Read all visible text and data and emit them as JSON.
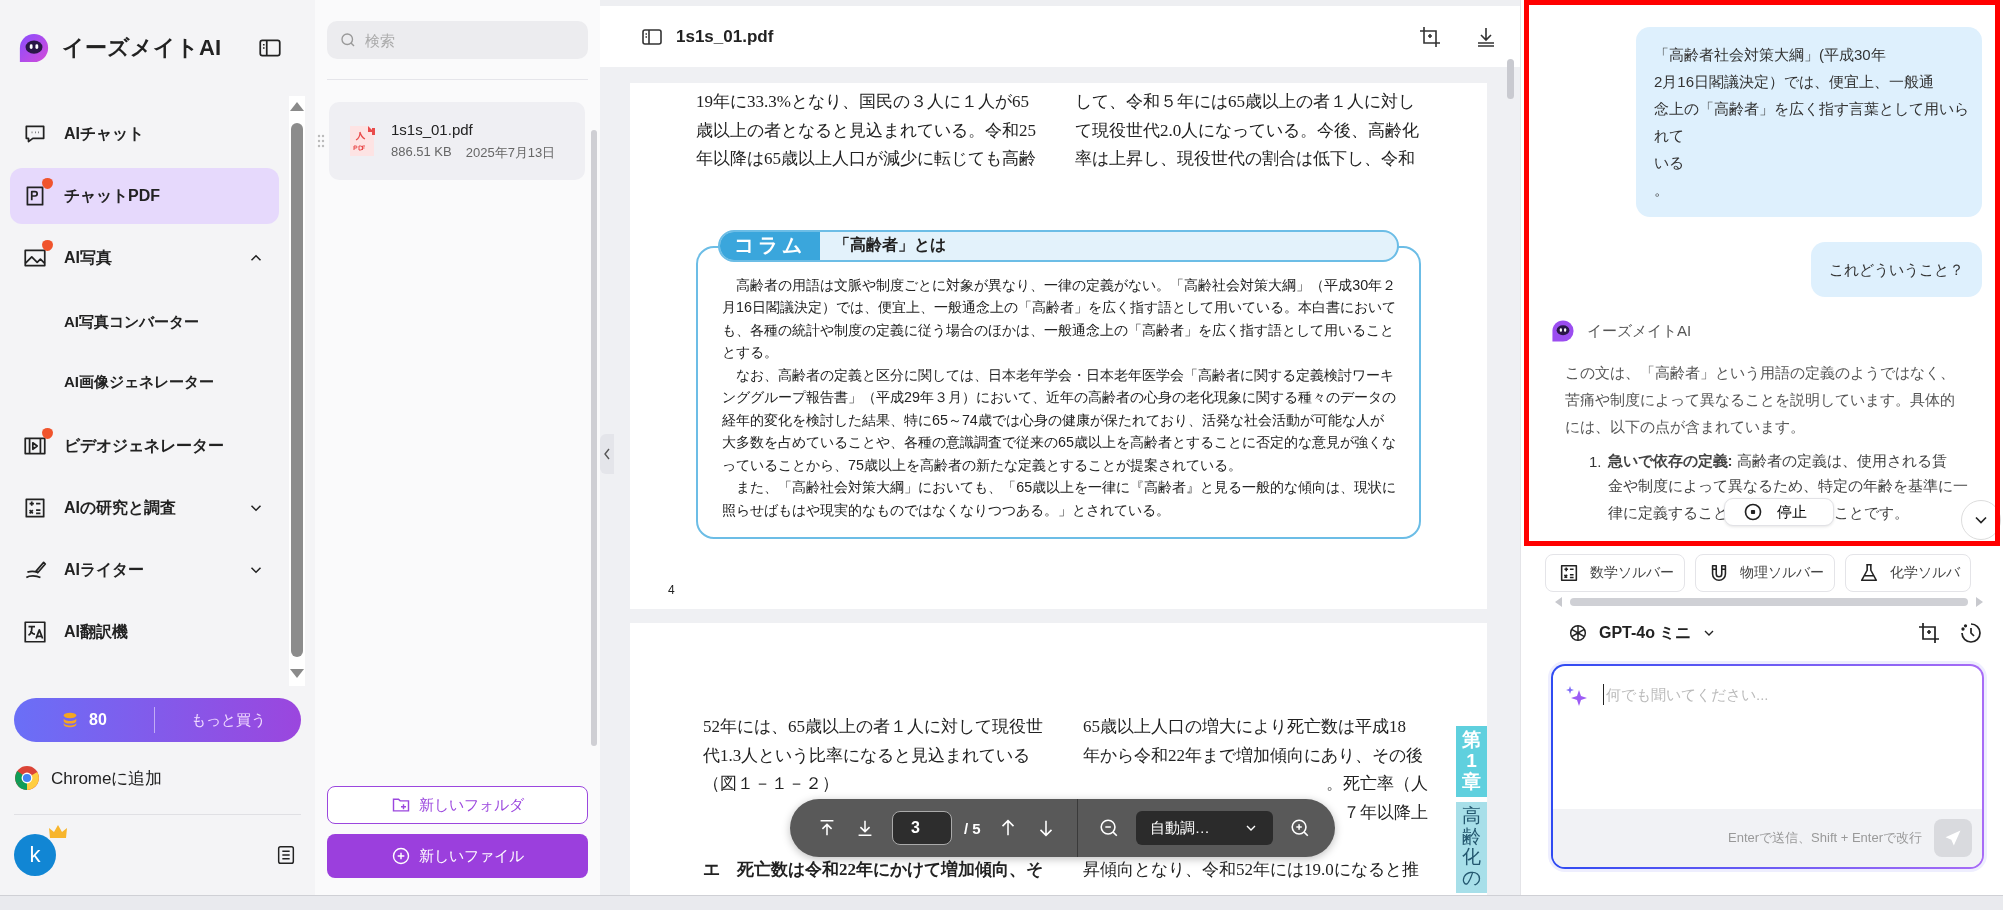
{
  "sidebar": {
    "app_name": "イーズメイトAI",
    "items": [
      {
        "label": "AIチャット",
        "selected": false,
        "badge": false
      },
      {
        "label": "チャットPDF",
        "selected": true,
        "badge": true
      },
      {
        "label": "AI写真",
        "selected": false,
        "badge": true,
        "expanded": true,
        "children": [
          {
            "label": "AI写真コンバーター",
            "selected": false
          },
          {
            "label": "AI画像ジェネレーター",
            "selected": false
          }
        ]
      },
      {
        "label": "ビデオジェネレーター",
        "selected": false,
        "badge": true
      },
      {
        "label": "AIの研究と調査",
        "selected": false,
        "badge": false,
        "expanded": false
      },
      {
        "label": "AIライター",
        "selected": false,
        "badge": false,
        "expanded": false
      },
      {
        "label": "AI翻訳機",
        "selected": false,
        "badge": false
      }
    ],
    "credits": {
      "count": "80",
      "buy_label": "もっと買う"
    },
    "extension": "Chromeに追加",
    "avatar": "k"
  },
  "files": {
    "search_placeholder": "検索",
    "items": [
      {
        "name": "1s1s_01.pdf",
        "size": "886.51 KB",
        "date": "2025年7月13日"
      }
    ],
    "new_folder": "新しいフォルダ",
    "new_file": "新しいファイル"
  },
  "viewer": {
    "title": "1s1s_01.pdf",
    "page_1": {
      "columns": [
        [
          "19年に33.3%となり、国民の３人に１人が65",
          "歳以上の者となると見込まれている。令和25",
          "年以降は65歳以上人口が減少に転じても高齢"
        ],
        [
          "して、令和５年には65歳以上の者１人に対し",
          "て現役世代2.0人になっている。今後、高齢化",
          "率は上昇し、現役世代の割合は低下し、令和"
        ]
      ],
      "column_box": {
        "tab": "コラム",
        "title": "「高齢者」とは",
        "paragraphs": [
          "高齢者の用語は文脈や制度ごとに対象が異なり、一律の定義がない。「高齢社会対策大綱」（平成30年２月16日閣議決定）では、便宜上、一般通念上の「高齢者」を広く指す語として用いている。本白書においても、各種の統計や制度の定義に従う場合のほかは、一般通念上の「高齢者」を広く指す語として用いることとする。",
          "なお、高齢者の定義と区分に関しては、日本老年学会・日本老年医学会「高齢者に関する定義検討ワーキンググループ報告書」（平成29年３月）において、近年の高齢者の心身の老化現象に関する種々のデータの経年的変化を検討した結果、特に65～74歳では心身の健康が保たれており、活発な社会活動が可能な人が大多数を占めていることや、各種の意識調査で従来の65歳以上を高齢者とすることに否定的な意見が強くなっていることから、75歳以上を高齢者の新たな定義とすることが提案されている。",
          "また、「高齢社会対策大綱」においても、「65歳以上を一律に『高齢者』と見る一般的な傾向は、現状に照らせばもはや現実的なものではなくなりつつある。」とされている。"
        ]
      },
      "page_number": "4"
    },
    "page_2": {
      "columns": [
        [
          {
            "kind": "line",
            "text": "52年には、65歳以上の者１人に対して現役世"
          },
          {
            "kind": "line",
            "text": "代1.3人という比率になると見込まれている"
          },
          {
            "kind": "line",
            "text": "（図１－１－２）"
          },
          {
            "kind": "heading",
            "text": "エ　死亡数は令和22年にかけて増加傾向、そ"
          }
        ],
        [
          {
            "kind": "line",
            "text": "65歳以上人口の増大により死亡数は平成18"
          },
          {
            "kind": "line",
            "text": "年から令和22年まで増加傾向にあり、その後"
          },
          {
            "kind": "fragment",
            "text": "。死亡率（人"
          },
          {
            "kind": "fragment",
            "text": "７年以降上"
          },
          {
            "kind": "line",
            "text": "昇傾向となり、令和52年には19.0になると推"
          }
        ]
      ],
      "side_tabs": [
        {
          "text": "第1章",
          "selected": true
        },
        {
          "text": "高齢化の",
          "selected": false
        }
      ]
    },
    "toolbar": {
      "page": "3",
      "total": "/ 5",
      "zoom": "自動調…"
    }
  },
  "chat": {
    "messages": [
      {
        "kind": "user",
        "lines": [
          "「高齢者社会対策大綱」(平成30年",
          "2月16日閣議決定）では、便宜上、一般通",
          "念上の「高齢者」を広く指す言葉として用いら",
          "れて",
          "いる",
          "。"
        ]
      },
      {
        "kind": "user",
        "lines": [
          "これどういうこと？"
        ]
      },
      {
        "kind": "assistant",
        "name": "イーズメイトAI",
        "paragraph": "この文は、「高齢者」という用語の定義のようではなく、苦痛や制度によって異なることを説明しています。具体的には、以下の点が含まれています。",
        "list": [
          {
            "number": "1.",
            "lines": [
              "**急いで依存の定義:** 高齢者の定義は、使用される賃",
              "金や制度によって異なるため、特定の年齢を基準に一",
              "律に定義すること"
            ],
            "tail": "ことです。"
          }
        ]
      }
    ],
    "stop_label": "停止",
    "tools": [
      {
        "label": "数学ソルバー"
      },
      {
        "label": "物理ソルバー"
      },
      {
        "label": "化学ソルバ"
      }
    ],
    "model": "GPT-4o ミニ",
    "input_placeholder": "何でも聞いてください...",
    "hint": "Enterで送信、Shift + Enterで改行"
  }
}
